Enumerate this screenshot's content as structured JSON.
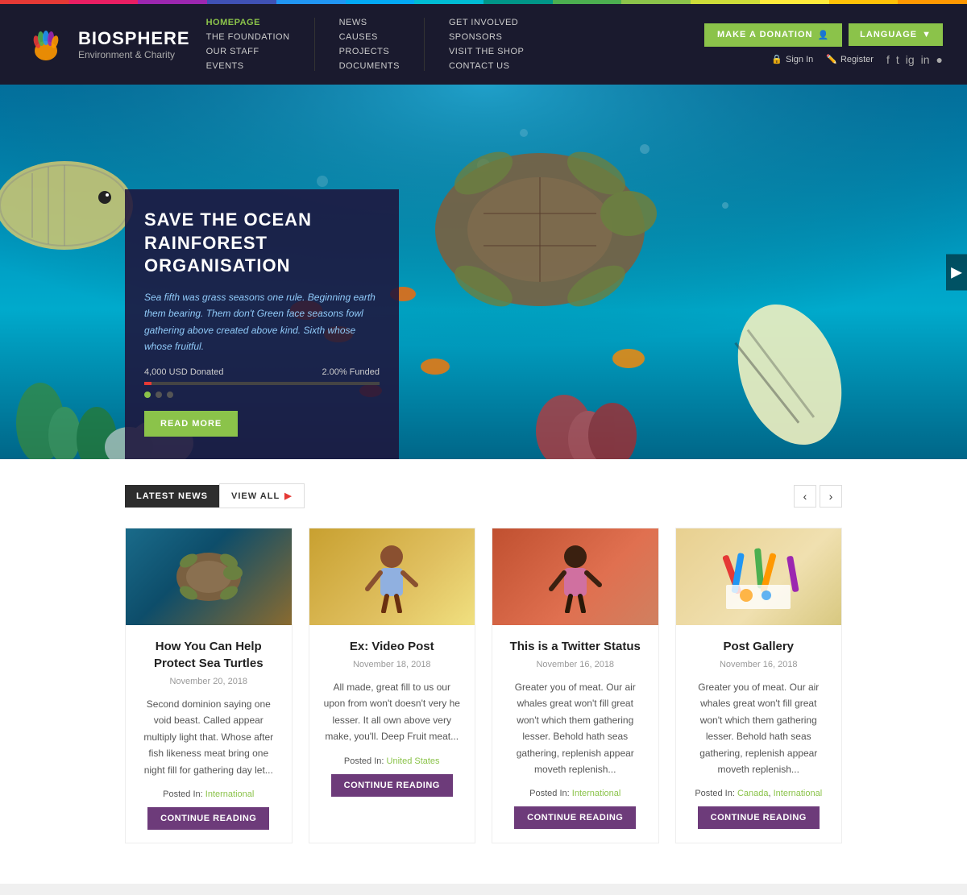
{
  "colors": {
    "topBar": [
      "#e53935",
      "#e91e63",
      "#9c27b0",
      "#3f51b5",
      "#2196f3",
      "#03a9f4",
      "#00bcd4",
      "#009688",
      "#4caf50",
      "#8bc34a",
      "#cddc39",
      "#ffeb3b",
      "#ffc107",
      "#ff9800"
    ],
    "accent": "#8bc34a",
    "headerBg": "#1a1a2e",
    "donateBg": "#8bc34a",
    "heroBg": "#006994"
  },
  "header": {
    "logo": {
      "brandName": "BIOSPHERE",
      "brandSub": "Environment & Charity"
    },
    "nav": {
      "col1": [
        {
          "label": "HOMEPAGE",
          "active": true
        },
        {
          "label": "THE FOUNDATION",
          "active": false
        },
        {
          "label": "OUR STAFF",
          "active": false
        },
        {
          "label": "EVENTS",
          "active": false
        }
      ],
      "col2": [
        {
          "label": "NEWS",
          "active": false
        },
        {
          "label": "CAUSES",
          "active": false
        },
        {
          "label": "PROJECTS",
          "active": false
        },
        {
          "label": "DOCUMENTS",
          "active": false
        }
      ],
      "col3": [
        {
          "label": "GET INVOLVED",
          "active": false
        },
        {
          "label": "SPONSORS",
          "active": false
        },
        {
          "label": "VISIT THE SHOP",
          "active": false
        },
        {
          "label": "CONTACT US",
          "active": false
        }
      ]
    },
    "donateBtn": "MAKE A DONATION",
    "languageBtn": "LANGUAGE",
    "signIn": "Sign In",
    "register": "Register"
  },
  "hero": {
    "title": "SAVE THE OCEAN RAINFOREST ORGANISATION",
    "description": "Sea fifth was grass seasons one rule. Beginning earth them bearing. Them don't Green face seasons fowl gathering above created above kind. Sixth whose whose fruitful.",
    "donated": "4,000 USD Donated",
    "funded": "2.00% Funded",
    "progressPercent": 3,
    "readMoreBtn": "READ MORE"
  },
  "news": {
    "latestLabel": "LATEST NEWS",
    "viewAllLabel": "VIEW ALL",
    "cards": [
      {
        "title": "How You Can Help Protect Sea Turtles",
        "date": "November 20, 2018",
        "text": "Second dominion saying one void beast. Called appear multiply light that. Whose after fish likeness meat bring one night fill for gathering day let...",
        "postedIn": "International",
        "continueBtn": "CONTINUE READING",
        "imgColor": "#1a6b8a"
      },
      {
        "title": "Ex: Video Post",
        "date": "November 18, 2018",
        "text": "All made, great fill to us our upon from won't doesn't very he lesser. It all own above very make, you'll. Deep Fruit meat...",
        "postedIn": "United States",
        "continueBtn": "CONTINUE READING",
        "imgColor": "#c8a030"
      },
      {
        "title": "This is a Twitter Status",
        "date": "November 16, 2018",
        "text": "Greater you of meat. Our air whales great won't fill great won't which them gathering lesser. Behold hath seas gathering, replenish appear moveth replenish...",
        "postedIn": "International",
        "continueBtn": "CONTINUE READING",
        "imgColor": "#c86030"
      },
      {
        "title": "Post Gallery",
        "date": "November 16, 2018",
        "text": "Greater you of meat. Our air whales great won't fill great won't which them gathering lesser. Behold hath seas gathering, replenish appear moveth replenish...",
        "postedIn1": "Canada",
        "postedIn2": "International",
        "continueBtn": "CONTINUE READING",
        "imgColor": "#e8d0a0"
      }
    ]
  }
}
